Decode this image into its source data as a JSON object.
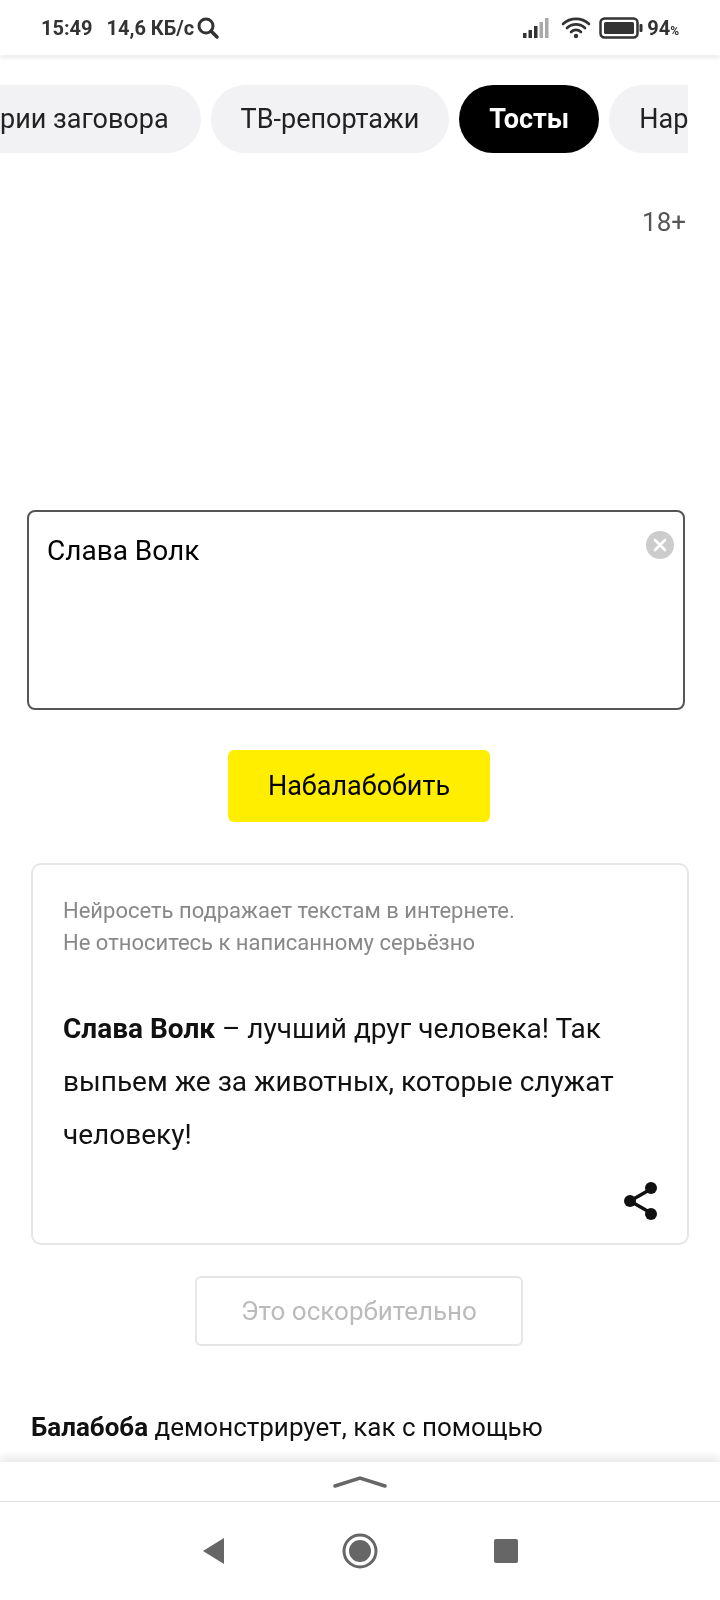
{
  "status_bar": {
    "time": "15:49",
    "speed": "14,6 КБ/с",
    "battery": "94",
    "percent_sign": "%"
  },
  "tabs": [
    {
      "label": "рии заговора",
      "selected": false
    },
    {
      "label": "ТВ-репортажи",
      "selected": false
    },
    {
      "label": "Тосты",
      "selected": true
    },
    {
      "label": "Нар",
      "selected": false
    }
  ],
  "age_rating": "18+",
  "input": {
    "value": "Слава Волк"
  },
  "generate_button": "Набалабобить",
  "result": {
    "disclaimer": "Нейросеть подражает текстам в интернете.\nНе относитесь к написанному серьёзно",
    "text": "**Слава Волк** – лучший друг человека! Так выпьем же за животных, которые служат человеку!"
  },
  "report_button": "Это оскорбительно",
  "about": "**Балабоба** демонстрирует, как с помощью"
}
